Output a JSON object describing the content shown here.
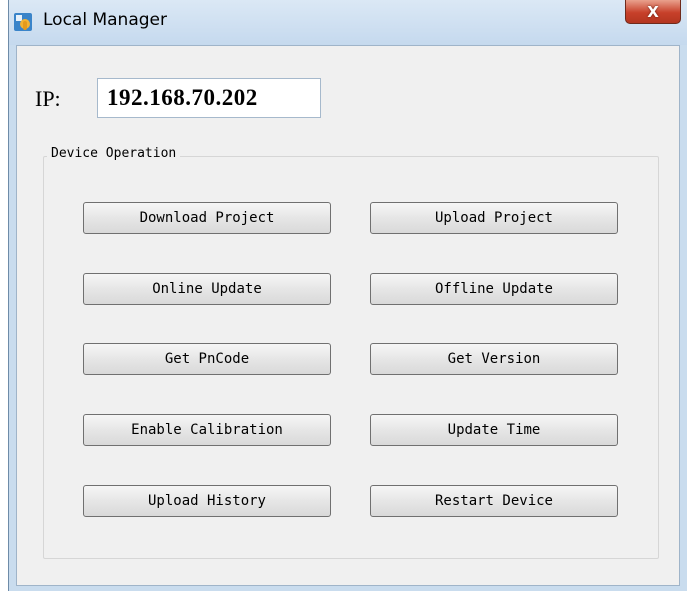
{
  "window": {
    "title": "Local Manager",
    "close_glyph": "X"
  },
  "ip": {
    "label": "IP:",
    "value": "192.168.70.202"
  },
  "device_operation": {
    "group_title": "Device Operation",
    "buttons": {
      "download_project": "Download Project",
      "upload_project": "Upload Project",
      "online_update": "Online Update",
      "offline_update": "Offline Update",
      "get_pncode": "Get PnCode",
      "get_version": "Get Version",
      "enable_calibration": "Enable Calibration",
      "update_time": "Update Time",
      "upload_history": "Upload History",
      "restart_device": "Restart Device"
    }
  },
  "icons": {
    "app": "app-icon",
    "close": "close-icon"
  },
  "colors": {
    "title_bar": "#c9dcee",
    "client_bg": "#f0f0f0",
    "close_button": "#c7402a"
  }
}
